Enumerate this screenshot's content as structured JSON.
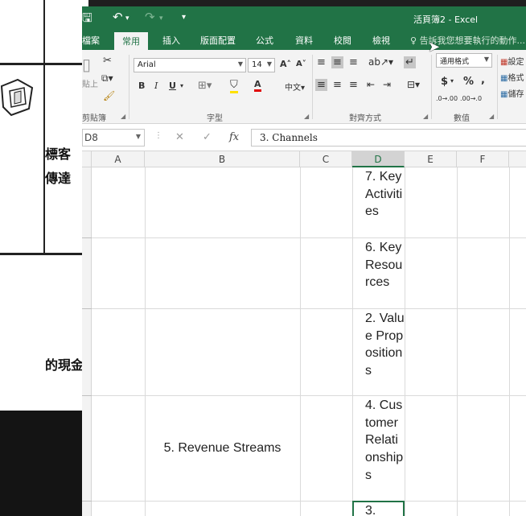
{
  "background_doc": {
    "line1": "標客",
    "line2": "傳達",
    "line3": "的現金。"
  },
  "title_bar": {
    "title": "活頁簿2 - Excel"
  },
  "ribbon_tabs": [
    "檔案",
    "常用",
    "插入",
    "版面配置",
    "公式",
    "資料",
    "校閱",
    "檢視"
  ],
  "tell_me": "告訴我您想要執行的動作...",
  "ribbon": {
    "paste_label": "貼上",
    "clipboard_label": "剪貼簿",
    "font_name": "Arial",
    "font_size": "14",
    "grow_font": "A˄",
    "shrink_font": "A˅",
    "bold": "B",
    "italic": "I",
    "underline": "U",
    "font_color_letter": "A",
    "font_group_label": "字型",
    "alignment_group_label": "對齊方式",
    "number_format": "通用格式",
    "currency": "$",
    "percent": "%",
    "comma": ",",
    "inc_decimal": ".0→.00",
    "dec_decimal": ".00→.0",
    "number_group_label": "數值",
    "cond_fmt": "設定",
    "table_fmt": "格式",
    "cell_style": "儲存"
  },
  "formula_bar": {
    "name_box": "D8",
    "fx": "fx",
    "content": "3. Channels"
  },
  "columns": [
    "A",
    "B",
    "C",
    "D",
    "E",
    "F"
  ],
  "rows": [
    {
      "b": "",
      "d": "7. Key Activities"
    },
    {
      "b": "",
      "d": "6. Key Resources"
    },
    {
      "b": "",
      "d": "2. Value Propositions"
    },
    {
      "b": "5. Revenue Streams",
      "d": "4. Customer Relationships"
    },
    {
      "b": "",
      "d": "3."
    }
  ],
  "colors": {
    "excel_green": "#217346",
    "ribbon_bg": "#f3f3f3"
  }
}
